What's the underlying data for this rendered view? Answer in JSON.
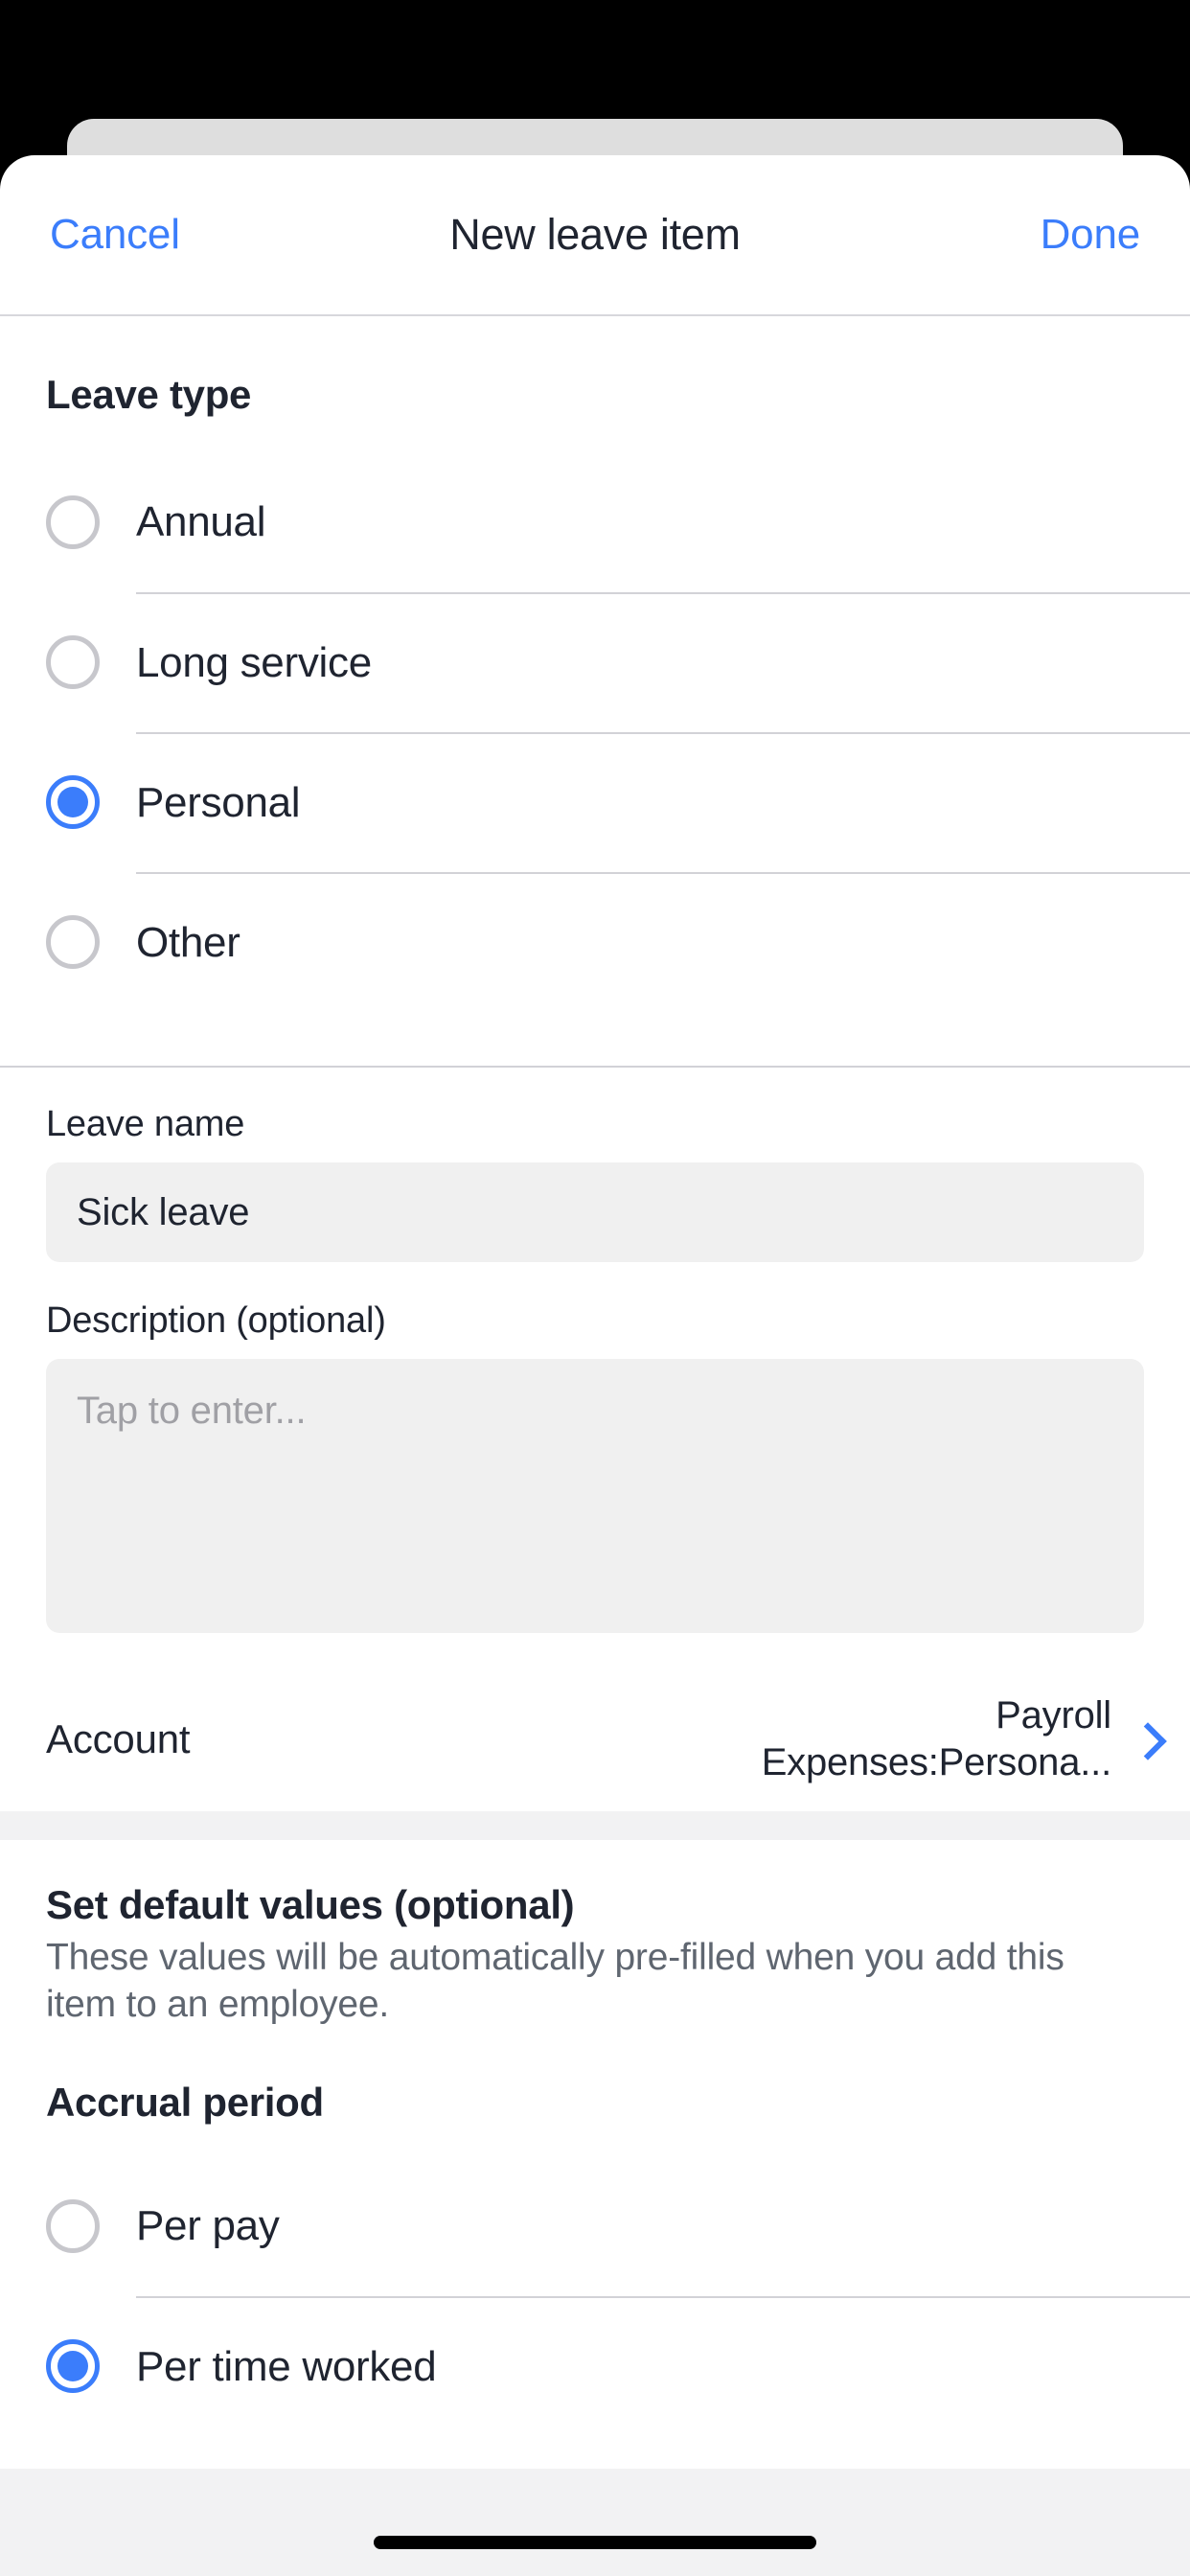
{
  "nav": {
    "cancel_label": "Cancel",
    "title": "New leave item",
    "done_label": "Done"
  },
  "leave_type": {
    "heading": "Leave type",
    "options": [
      {
        "label": "Annual",
        "selected": false
      },
      {
        "label": "Long service",
        "selected": false
      },
      {
        "label": "Personal",
        "selected": true
      },
      {
        "label": "Other",
        "selected": false
      }
    ]
  },
  "form": {
    "leave_name": {
      "label": "Leave name",
      "value": "Sick leave"
    },
    "description": {
      "label": "Description (optional)",
      "value": "",
      "placeholder": "Tap to enter..."
    },
    "account": {
      "label": "Account",
      "value": "Payroll Expenses:Persona..."
    }
  },
  "defaults": {
    "heading": "Set default values (optional)",
    "description": "These values will be automatically pre-filled when you add this item to an employee."
  },
  "accrual_period": {
    "heading": "Accrual period",
    "options": [
      {
        "label": "Per pay",
        "selected": false
      },
      {
        "label": "Per time worked",
        "selected": true
      }
    ]
  },
  "colors": {
    "accent": "#3b7dfb",
    "text": "#1f2430",
    "muted": "#5f6670",
    "placeholder": "#a0a0a5",
    "field_bg": "#f0f0f0",
    "divider": "#d2d2d7",
    "band": "#f2f2f3"
  }
}
